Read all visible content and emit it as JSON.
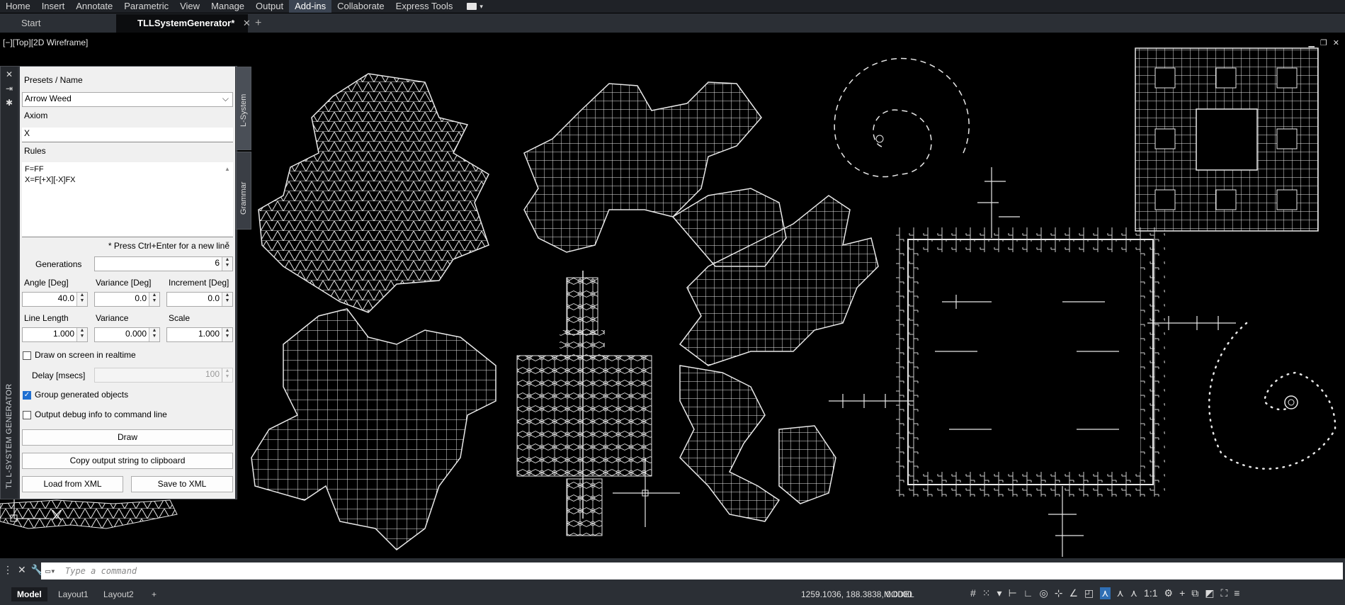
{
  "ribbon": {
    "tabs": [
      "Home",
      "Insert",
      "Annotate",
      "Parametric",
      "View",
      "Manage",
      "Output",
      "Add-ins",
      "Collaborate",
      "Express Tools"
    ],
    "active": "Add-ins"
  },
  "doc_tabs": {
    "start": "Start",
    "current": "TLLSystemGenerator*",
    "close": "✕",
    "add": "+"
  },
  "viewport": {
    "label": "[−][Top][2D Wireframe]",
    "controls": [
      "▁",
      "❐",
      "✕"
    ]
  },
  "palette": {
    "vertical_title": "TL L-SYSTEM GENERATOR",
    "side_tabs": [
      "L-System",
      "Grammar"
    ],
    "presets_label": "Presets / Name",
    "preset_value": "Arrow Weed",
    "axiom_label": "Axiom",
    "axiom_value": "X",
    "rules_label": "Rules",
    "rules_line1": "F=FF",
    "rules_line2": "X=F[+X][-X]FX",
    "hint": "* Press Ctrl+Enter for a new line",
    "generations_label": "Generations",
    "generations_value": "6",
    "angle_label": "Angle [Deg]",
    "angle_value": "40.0",
    "variance_deg_label": "Variance [Deg]",
    "variance_deg_value": "0.0",
    "increment_label": "Increment [Deg]",
    "increment_value": "0.0",
    "line_length_label": "Line Length",
    "line_length_value": "1.000",
    "variance_label": "Variance",
    "variance_value": "0.000",
    "scale_label": "Scale",
    "scale_value": "1.000",
    "realtime_label": "Draw on screen in realtime",
    "delay_label": "Delay [msecs]",
    "delay_value": "100",
    "group_label": "Group generated objects",
    "debug_label": "Output debug info to command line",
    "draw_button": "Draw",
    "copy_button": "Copy output string to clipboard",
    "load_button": "Load from XML",
    "save_button": "Save to XML"
  },
  "command": {
    "placeholder": "Type a command"
  },
  "status": {
    "layouts": [
      "Model",
      "Layout1",
      "Layout2"
    ],
    "add": "+",
    "coords": "1259.1036, 188.3838, 0.0000",
    "model": "MODEL",
    "scale": "1:1"
  }
}
